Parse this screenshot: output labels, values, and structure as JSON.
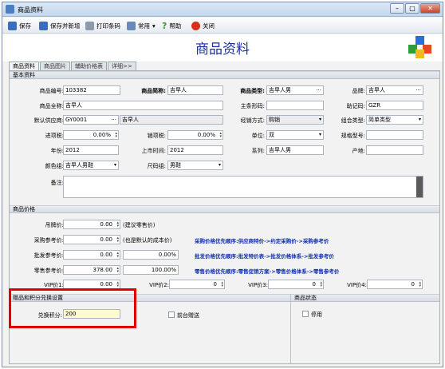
{
  "window": {
    "title": "商品资料"
  },
  "toolbar": {
    "save": "保存",
    "save_new": "保存并新增",
    "print_barcode": "打印条码",
    "common": "常用",
    "help": "帮助",
    "close": "关闭"
  },
  "header": {
    "title": "商品资料"
  },
  "tabs": [
    "商品资料",
    "商品图片",
    "辅助价格表",
    "详细>>"
  ],
  "basic": {
    "section": "基本资料",
    "code_label": "商品编号:",
    "code": "103382",
    "short_name_label": "商品简称:",
    "short_name": "吉早人",
    "type_label": "商品类型:",
    "type": "吉早人男",
    "brand_label": "品牌:",
    "brand": "吉早人",
    "full_name_label": "商品全称:",
    "full_name": "吉早人",
    "barcode_label": "主条形码:",
    "barcode": "",
    "mnemonic_label": "助记码:",
    "mnemonic": "GZR",
    "supplier_label": "默认供应商:",
    "supplier_code": "GY0001",
    "supplier_name": "吉早人",
    "biz_mode_label": "经销方式:",
    "biz_mode": "购销",
    "combo_label": "组合类型:",
    "combo": "简单类型",
    "input_tax_label": "进项税:",
    "input_tax": "0.00%",
    "output_tax_label": "销项税:",
    "output_tax": "0.00%",
    "unit_label": "单位:",
    "unit": "双",
    "spec_label": "规格型号:",
    "spec": "",
    "year_label": "年份:",
    "year": "2012",
    "launch_label": "上市时间:",
    "launch": "2012",
    "series_label": "系列:",
    "series": "吉早人男",
    "origin_label": "产地:",
    "origin": "",
    "color_label": "颜色组:",
    "color": "吉早人男鞋",
    "size_label": "尺码组:",
    "size": "男鞋",
    "remark_label": "备注:"
  },
  "price": {
    "section": "商品价格",
    "tag_label": "吊牌价:",
    "tag": "0.00",
    "tag_note": "(建议零售价)",
    "purchase_label": "采购参考价:",
    "purchase": "0.00",
    "purchase_note": "(也是默认的成本价)",
    "purchase_priority": "采购价格优先顺序:供应商特价->约定采购价->采购参考价",
    "wholesale_label": "批发参考价:",
    "wholesale": "0.00",
    "wholesale_pct": "0.00%",
    "wholesale_priority": "批发价格优先顺序:批发特价表->批发价格体系->批发参考价",
    "retail_label": "零售参考价:",
    "retail": "378.00",
    "retail_pct": "100.00%",
    "retail_priority": "零售价格优先顺序:零售促销方案->零售价格体系->零售参考价",
    "vip1_label": "VIP价1:",
    "vip1": "0.00",
    "vip2_label": "VIP价2:",
    "vip2": "0",
    "vip3_label": "VIP价3:",
    "vip3": "0",
    "vip4_label": "VIP价4:",
    "vip4": "0"
  },
  "gift": {
    "section": "赠品和积分兑换设置",
    "points_label": "兑换积分:",
    "points": "200",
    "front_gift_label": "前台赠送"
  },
  "status": {
    "section": "商品状态",
    "disabled_label": "停用"
  }
}
